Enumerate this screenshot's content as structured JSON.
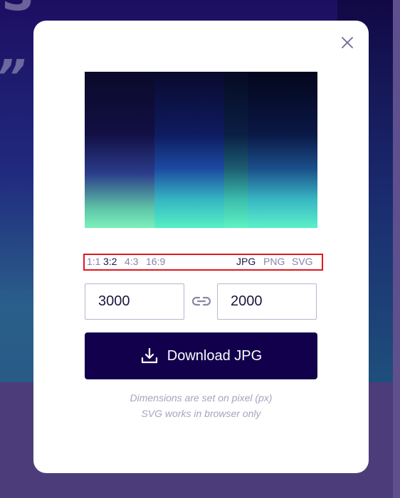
{
  "background": {
    "glyph_top": "S",
    "glyph_mid": "”"
  },
  "modal": {
    "close_icon": "close-icon",
    "aspect_ratios": [
      "1:1",
      "3:2",
      "4:3",
      "16:9"
    ],
    "selected_ratio": "3:2",
    "formats": [
      "JPG",
      "PNG",
      "SVG"
    ],
    "selected_format": "JPG",
    "width_value": "3000",
    "height_value": "2000",
    "link_icon": "link-icon",
    "download_icon": "download-icon",
    "download_label": "Download JPG",
    "hint_line1": "Dimensions are set on pixel (px)",
    "hint_line2": "SVG works in browser only"
  },
  "colors": {
    "button_bg": "#12004d",
    "highlight_border": "#e0181f",
    "muted_text": "#8883aa"
  }
}
